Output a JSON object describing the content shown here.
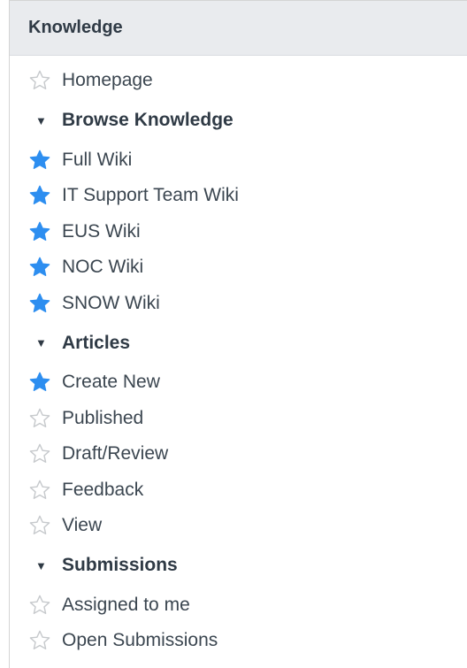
{
  "header": {
    "title": "Knowledge"
  },
  "top_items": [
    {
      "label": "Homepage",
      "starred": false
    }
  ],
  "sections": [
    {
      "title": "Browse Knowledge",
      "items": [
        {
          "label": "Full Wiki",
          "starred": true
        },
        {
          "label": "IT Support Team Wiki",
          "starred": true
        },
        {
          "label": "EUS Wiki",
          "starred": true
        },
        {
          "label": "NOC Wiki",
          "starred": true
        },
        {
          "label": "SNOW Wiki",
          "starred": true
        }
      ]
    },
    {
      "title": "Articles",
      "items": [
        {
          "label": "Create New",
          "starred": true
        },
        {
          "label": "Published",
          "starred": false
        },
        {
          "label": "Draft/Review",
          "starred": false
        },
        {
          "label": "Feedback",
          "starred": false
        },
        {
          "label": "View",
          "starred": false
        }
      ]
    },
    {
      "title": "Submissions",
      "items": [
        {
          "label": "Assigned to me",
          "starred": false
        },
        {
          "label": "Open Submissions",
          "starred": false
        }
      ]
    }
  ],
  "icons": {
    "caret": "caret-down-icon",
    "star_filled": "star-filled-icon",
    "star_outline": "star-outline-icon"
  },
  "colors": {
    "star_filled": "#2d8ef0",
    "star_outline": "#c6c9cc",
    "header_bg": "#e9ebee",
    "text": "#3b4650"
  }
}
